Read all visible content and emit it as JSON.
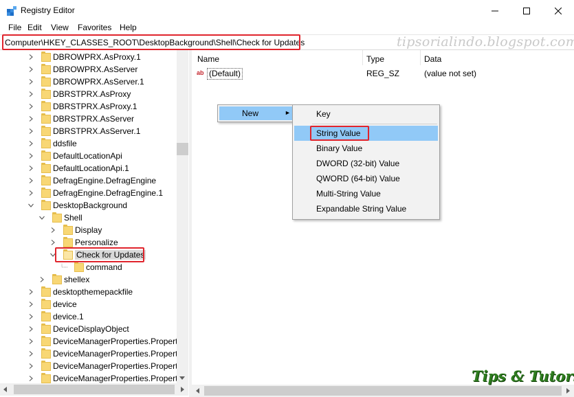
{
  "window": {
    "title": "Registry Editor",
    "minimize_glyph": "—",
    "maximize_glyph": "☐",
    "close_glyph": "✕"
  },
  "menu": [
    "File",
    "Edit",
    "View",
    "Favorites",
    "Help"
  ],
  "address": "Computer\\HKEY_CLASSES_ROOT\\DesktopBackground\\Shell\\Check for Updates",
  "watermark": "tipsorialindo.blogspot.com",
  "watermark_bottom": "Tips & Tutorial",
  "tree": [
    {
      "label": "DBROWPRX.AsProxy.1",
      "indent": 0,
      "expander": "collapsed"
    },
    {
      "label": "DBROWPRX.AsServer",
      "indent": 0,
      "expander": "collapsed"
    },
    {
      "label": "DBROWPRX.AsServer.1",
      "indent": 0,
      "expander": "collapsed"
    },
    {
      "label": "DBRSTPRX.AsProxy",
      "indent": 0,
      "expander": "collapsed"
    },
    {
      "label": "DBRSTPRX.AsProxy.1",
      "indent": 0,
      "expander": "collapsed"
    },
    {
      "label": "DBRSTPRX.AsServer",
      "indent": 0,
      "expander": "collapsed"
    },
    {
      "label": "DBRSTPRX.AsServer.1",
      "indent": 0,
      "expander": "collapsed"
    },
    {
      "label": "ddsfile",
      "indent": 0,
      "expander": "collapsed"
    },
    {
      "label": "DefaultLocationApi",
      "indent": 0,
      "expander": "collapsed"
    },
    {
      "label": "DefaultLocationApi.1",
      "indent": 0,
      "expander": "collapsed"
    },
    {
      "label": "DefragEngine.DefragEngine",
      "indent": 0,
      "expander": "collapsed"
    },
    {
      "label": "DefragEngine.DefragEngine.1",
      "indent": 0,
      "expander": "collapsed"
    },
    {
      "label": "DesktopBackground",
      "indent": 0,
      "expander": "expanded"
    },
    {
      "label": "Shell",
      "indent": 1,
      "expander": "expanded"
    },
    {
      "label": "Display",
      "indent": 2,
      "expander": "collapsed"
    },
    {
      "label": "Personalize",
      "indent": 2,
      "expander": "collapsed"
    },
    {
      "label": "Check for Updates",
      "indent": 2,
      "expander": "expanded",
      "selected": true
    },
    {
      "label": "command",
      "indent": 3,
      "expander": "none"
    },
    {
      "label": "shellex",
      "indent": 1,
      "expander": "collapsed"
    },
    {
      "label": "desktopthemepackfile",
      "indent": 0,
      "expander": "collapsed"
    },
    {
      "label": "device",
      "indent": 0,
      "expander": "collapsed"
    },
    {
      "label": "device.1",
      "indent": 0,
      "expander": "collapsed"
    },
    {
      "label": "DeviceDisplayObject",
      "indent": 0,
      "expander": "collapsed"
    },
    {
      "label": "DeviceManagerProperties.Properti",
      "indent": 0,
      "expander": "collapsed"
    },
    {
      "label": "DeviceManagerProperties.Properti",
      "indent": 0,
      "expander": "collapsed"
    },
    {
      "label": "DeviceManagerProperties.Properti",
      "indent": 0,
      "expander": "collapsed"
    },
    {
      "label": "DeviceManagerProperties.Properti",
      "indent": 0,
      "expander": "collapsed"
    }
  ],
  "columns": {
    "name": "Name",
    "type": "Type",
    "data": "Data"
  },
  "values": [
    {
      "icon": "ab",
      "name": "(Default)",
      "type": "REG_SZ",
      "data": "(value not set)"
    }
  ],
  "context_menu": {
    "new_label": "New",
    "submenu": [
      "Key",
      "String Value",
      "Binary Value",
      "DWORD (32-bit) Value",
      "QWORD (64-bit) Value",
      "Multi-String Value",
      "Expandable String Value"
    ],
    "highlighted": "String Value"
  },
  "colors": {
    "highlight_box": "#e0242c",
    "menu_hover": "#91c9f7",
    "folder": "#f8d775",
    "watermark_green": "#2f7d1f"
  }
}
